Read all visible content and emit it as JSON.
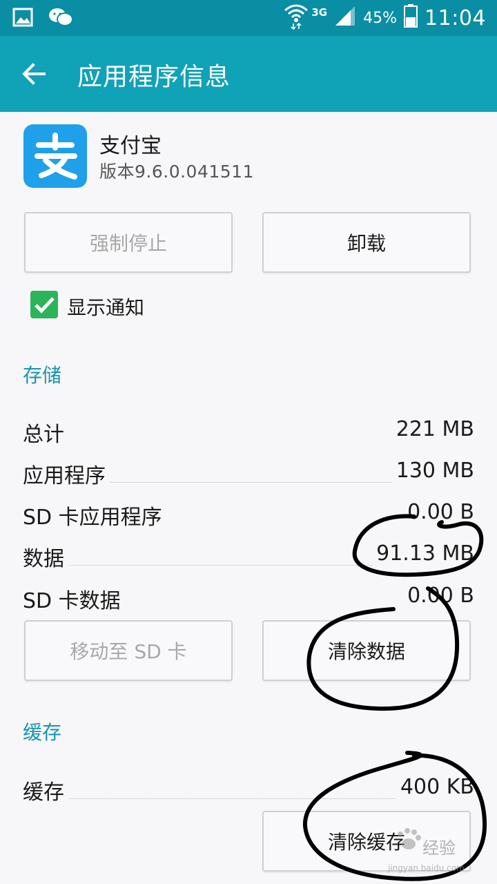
{
  "status_bar": {
    "network": "3G",
    "battery_percent": "45%",
    "time": "11:04",
    "battery_level": 0.45,
    "icons": [
      "gallery-icon",
      "wechat-icon",
      "wifi-icon",
      "signal-icon",
      "battery-icon"
    ]
  },
  "app_bar": {
    "title": "应用程序信息",
    "back_icon": "arrow-left-icon"
  },
  "app": {
    "name": "支付宝",
    "version": "版本9.6.0.041511",
    "icon_glyph": "支",
    "icon_color": "#1fa0ea"
  },
  "actions": {
    "force_stop": "强制停止",
    "uninstall": "卸载"
  },
  "notification": {
    "label": "显示通知",
    "checked": true
  },
  "storage": {
    "section_title": "存储",
    "rows": [
      {
        "label": "总计",
        "value": "221 MB"
      },
      {
        "label": "应用程序",
        "value": "130 MB"
      },
      {
        "label": "SD 卡应用程序",
        "value": "0.00 B"
      },
      {
        "label": "数据",
        "value": "91.13 MB"
      },
      {
        "label": "SD 卡数据",
        "value": "0.00 B"
      }
    ],
    "move_to_sd": "移动至 SD 卡",
    "clear_data": "清除数据"
  },
  "cache": {
    "section_title": "缓存",
    "label": "缓存",
    "value": "400 KB",
    "clear_cache": "清除缓存"
  },
  "watermark": {
    "text": "经验",
    "sub": "jingyan.baidu.com"
  },
  "colors": {
    "statusbar": "#0a8ea4",
    "appbar": "#10a2b7",
    "accent": "#1496ae",
    "checkbox": "#2cb45a"
  }
}
